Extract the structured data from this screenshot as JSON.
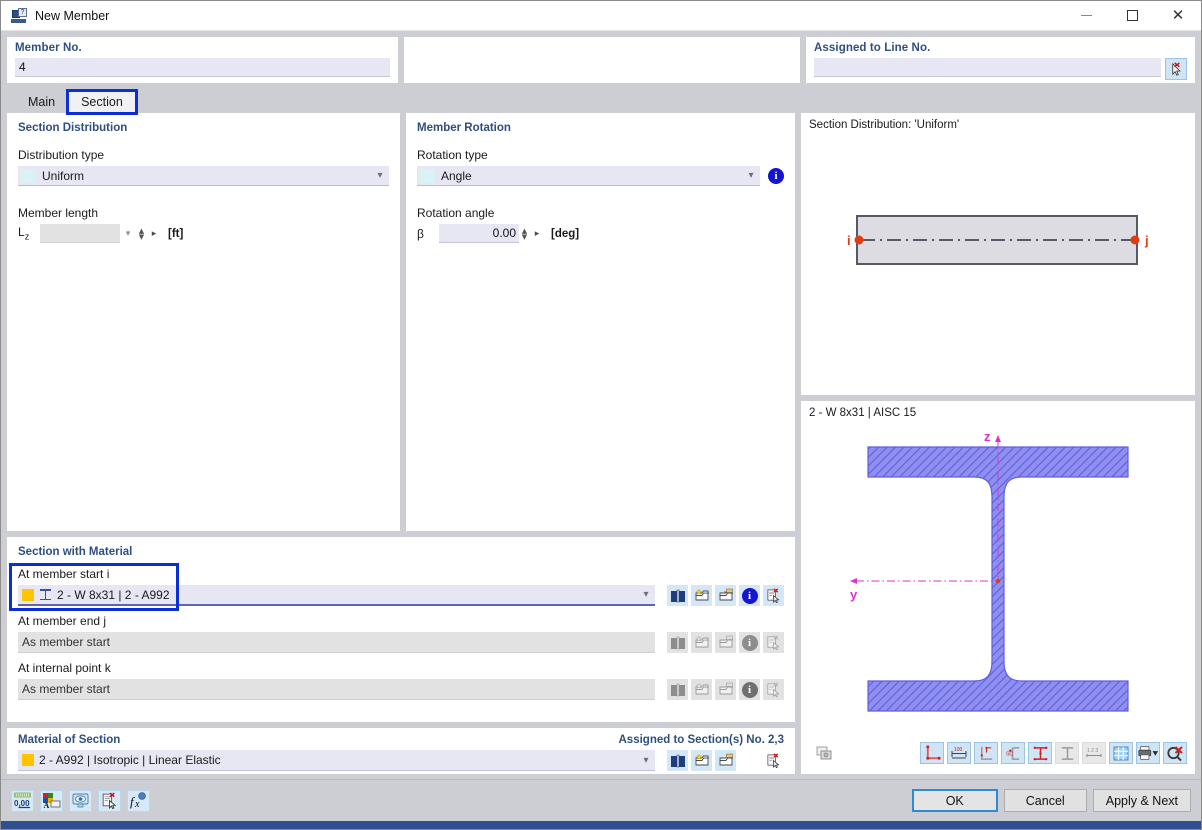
{
  "window": {
    "title": "New Member",
    "icon": "member-dialog-icon",
    "controls": {
      "minimize": "—",
      "maximize": "□",
      "close": "✕"
    }
  },
  "header": {
    "member_no": {
      "label": "Member No.",
      "value": "4"
    },
    "middle": {
      "label": "",
      "value": ""
    },
    "assigned_line": {
      "label": "Assigned to Line No.",
      "value": "",
      "pick_icon": "pick-line-icon"
    }
  },
  "tabs": [
    {
      "label": "Main",
      "active": false
    },
    {
      "label": "Section",
      "active": true
    }
  ],
  "section_distribution": {
    "title": "Section Distribution",
    "distribution_type_label": "Distribution type",
    "distribution_type_value": "Uniform",
    "member_length_label": "Member length",
    "lz_symbol": "L",
    "lz_subscript": "z",
    "lz_value": "",
    "lz_unit": "[ft]"
  },
  "member_rotation": {
    "title": "Member Rotation",
    "rotation_type_label": "Rotation type",
    "rotation_type_value": "Angle",
    "info_icon": "info-icon",
    "rotation_angle_label": "Rotation angle",
    "beta_symbol": "β",
    "beta_value": "0.00",
    "beta_unit": "[deg]"
  },
  "section_with_material": {
    "title": "Section with Material",
    "rows": [
      {
        "label": "At member start i",
        "value": "2 - W 8x31 | 2 - A992",
        "enabled": true,
        "highlighted": true,
        "color_swatch": "#ffc400",
        "shape_icon": "i-beam-icon"
      },
      {
        "label": "At member end j",
        "value": "As member start",
        "enabled": false,
        "highlighted": false
      },
      {
        "label": "At internal point k",
        "value": "As member start",
        "enabled": false,
        "highlighted": false
      }
    ],
    "row_buttons": [
      {
        "name": "section-library-icon",
        "title": "Library"
      },
      {
        "name": "new-section-icon",
        "title": "New"
      },
      {
        "name": "edit-section-icon",
        "title": "Edit"
      },
      {
        "name": "info-icon",
        "title": "Info"
      },
      {
        "name": "pick-section-icon",
        "title": "Pick"
      }
    ]
  },
  "material_of_section": {
    "title": "Material of Section",
    "assigned_text": "Assigned to Section(s) No. 2,3",
    "value": "2 - A992 | Isotropic | Linear Elastic",
    "color_swatch": "#ffc400",
    "buttons": [
      {
        "name": "material-library-icon"
      },
      {
        "name": "new-material-icon"
      },
      {
        "name": "edit-material-icon"
      },
      {
        "name": "pick-material-icon"
      }
    ]
  },
  "preview_distribution": {
    "caption": "Section Distribution: 'Uniform'",
    "node_i_label": "i",
    "node_j_label": "j",
    "node_color": "#e03c12",
    "member_fill": "#dcdce2",
    "member_stroke": "#555a66"
  },
  "preview_section": {
    "caption": "2 - W 8x31 | AISC 15",
    "axis_z_label": "z",
    "axis_y_label": "y",
    "axis_color": "#e030d0",
    "hatch_color": "#6a6ae0",
    "toolbar": [
      {
        "name": "snapshot-icon",
        "state": "off"
      },
      {
        "name": "show-corner-points-icon",
        "state": "on"
      },
      {
        "name": "show-dimensions-icon",
        "state": "on"
      },
      {
        "name": "show-local-axes-icon",
        "state": "on"
      },
      {
        "name": "show-shear-center-icon",
        "state": "on"
      },
      {
        "name": "show-stress-points-icon",
        "state": "on"
      },
      {
        "name": "show-section-outline-icon",
        "state": "off"
      },
      {
        "name": "show-part-numbers-icon",
        "state": "off"
      },
      {
        "name": "show-grid-icon",
        "state": "on"
      },
      {
        "name": "print-icon",
        "state": "on"
      },
      {
        "name": "reset-view-icon",
        "state": "on"
      }
    ]
  },
  "footer": {
    "tool_buttons": [
      {
        "name": "number-format-icon",
        "label": "0,00"
      },
      {
        "name": "display-properties-icon"
      },
      {
        "name": "visibility-icon"
      },
      {
        "name": "pick-icon"
      },
      {
        "name": "formula-icon",
        "label": "f"
      }
    ],
    "dialog_buttons": [
      {
        "label": "OK",
        "primary": true,
        "name": "ok-button"
      },
      {
        "label": "Cancel",
        "primary": false,
        "name": "cancel-button"
      },
      {
        "label": "Apply & Next",
        "primary": false,
        "name": "apply-next-button"
      }
    ]
  }
}
